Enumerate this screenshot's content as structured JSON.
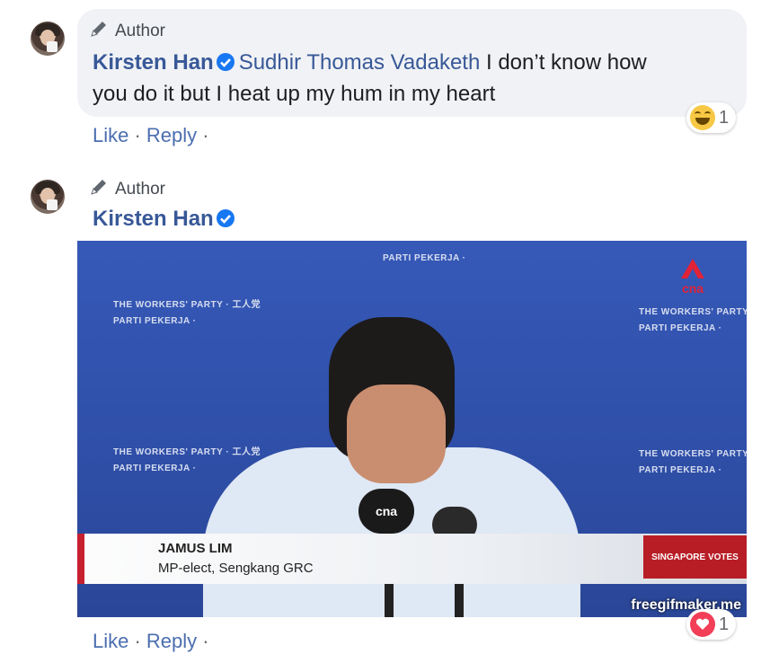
{
  "comments": [
    {
      "badge_label": "Author",
      "author": "Kirsten Han",
      "mention": "Sudhir Thomas Vadaketh",
      "text_line1": " I don’t know how",
      "text_line2": "you do it but I heat up my hum in my heart",
      "actions": {
        "like": "Like",
        "sep1": " · ",
        "reply": "Reply",
        "sep2": " ·"
      },
      "reaction": {
        "icon": "haha-emoji-icon",
        "count": "1"
      }
    },
    {
      "badge_label": "Author",
      "author": "Kirsten Han",
      "gif": {
        "watermark_line1": "THE WORKERS' PARTY · 工人党",
        "watermark_line2": "PARTI PEKERJA · ",
        "channel_logo": "cna",
        "mic_label": "cna",
        "lower_third_name": "JAMUS LIM",
        "lower_third_role": "MP-elect, Sengkang GRC",
        "corner_badge": "SINGAPORE VOTES",
        "credit": "freegifmaker.me"
      },
      "actions": {
        "like": "Like",
        "sep1": " · ",
        "reply": "Reply",
        "sep2": " ·"
      },
      "reaction": {
        "icon": "love-emoji-icon",
        "count": "1"
      }
    }
  ],
  "colors": {
    "link": "#385898",
    "bubble": "#f0f2f5",
    "verified": "#1877f2",
    "love": "#f33e58"
  }
}
